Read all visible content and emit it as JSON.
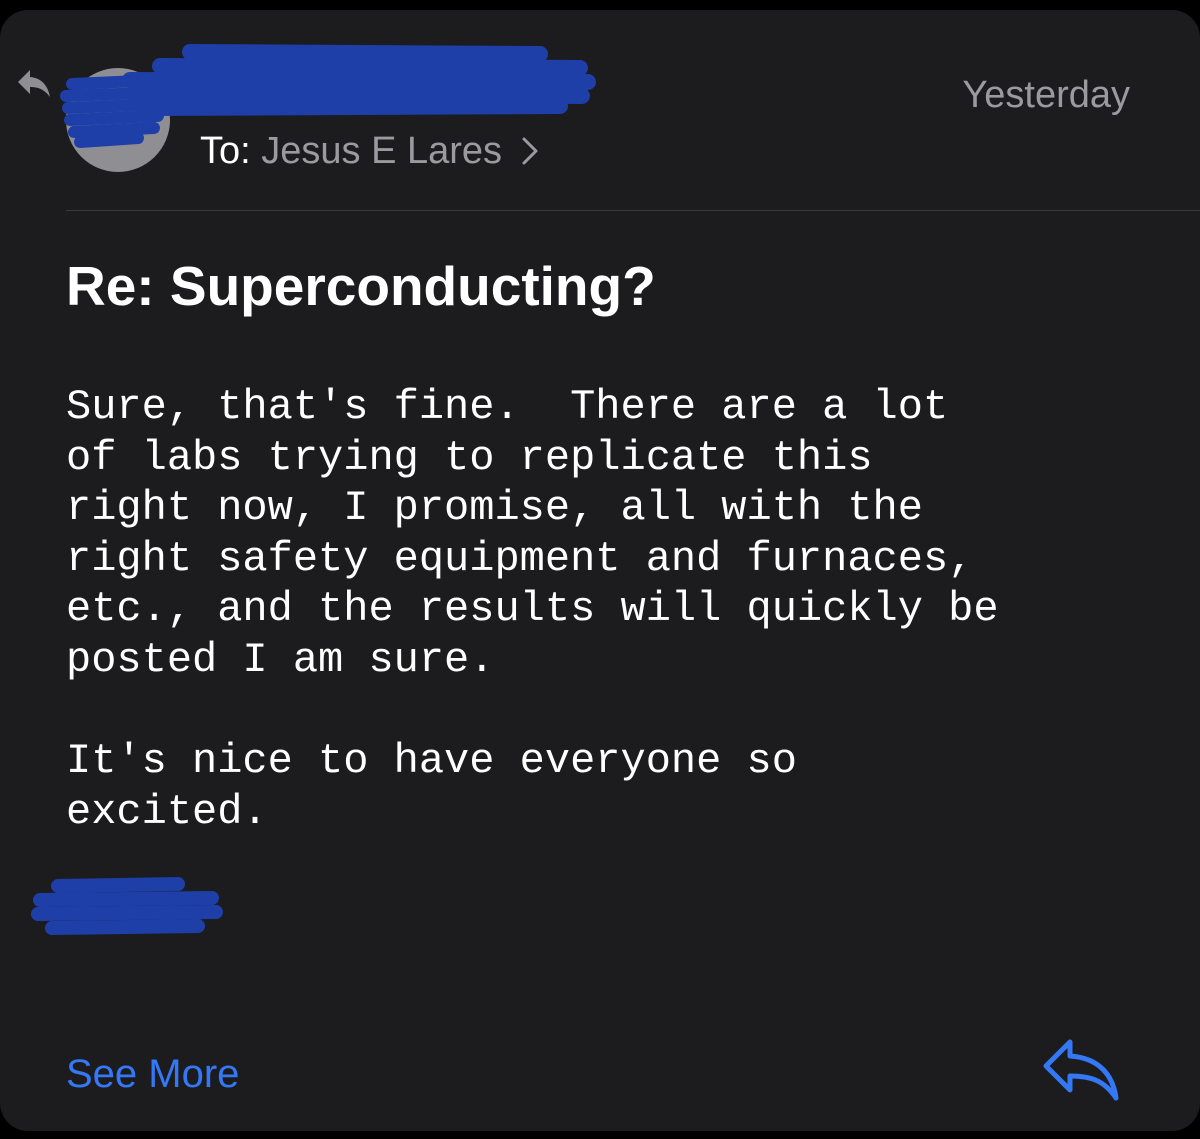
{
  "header": {
    "to_label": "To:",
    "recipient": "Jesus E Lares",
    "date": "Yesterday"
  },
  "message": {
    "subject": "Re: Superconducting?",
    "paragraphs": [
      "Sure, that's fine.  There are a lot\nof labs trying to replicate this\nright now, I promise, all with the\nright safety equipment and furnaces,\netc., and the results will quickly be\nposted I am sure.",
      "It's nice to have everyone so\nexcited."
    ]
  },
  "footer": {
    "see_more": "See More"
  },
  "icons": {
    "replied_indicator": "reply-arrow-icon",
    "reply": "reply-icon",
    "recipient_chevron": "chevron-right-icon"
  },
  "colors": {
    "background": "#1c1c1e",
    "accent": "#3478f6",
    "secondary_text": "#9a9aa0",
    "redaction": "#1e3fa8"
  }
}
